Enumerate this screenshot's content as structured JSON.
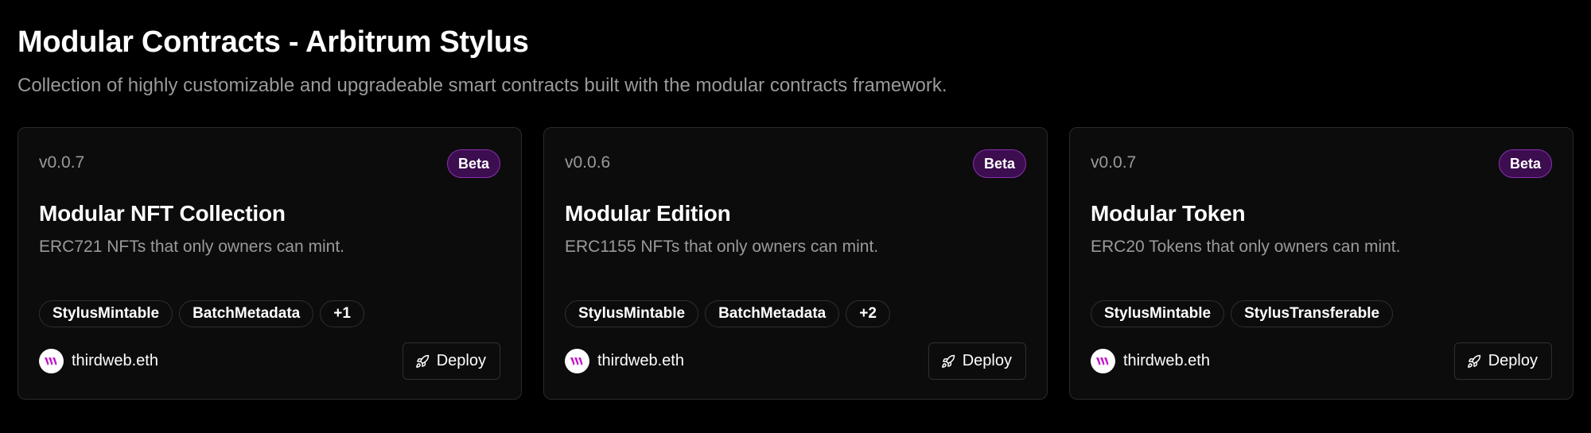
{
  "header": {
    "title": "Modular Contracts - Arbitrum Stylus",
    "subtitle": "Collection of highly customizable and upgradeable smart contracts built with the modular contracts framework."
  },
  "colors": {
    "background": "#000000",
    "card": "#0c0c0d",
    "badge_bg": "#3c0d4f",
    "badge_border": "#8a2fb3",
    "logo": "#c019c9"
  },
  "cards": [
    {
      "version": "v0.0.7",
      "badge": "Beta",
      "title": "Modular NFT Collection",
      "description": "ERC721 NFTs that only owners can mint.",
      "tags": [
        "StylusMintable",
        "BatchMetadata",
        "+1"
      ],
      "author": "thirdweb.eth",
      "author_icon": "thirdweb-logo-icon",
      "deploy_label": "Deploy",
      "deploy_icon": "rocket-icon"
    },
    {
      "version": "v0.0.6",
      "badge": "Beta",
      "title": "Modular Edition",
      "description": "ERC1155 NFTs that only owners can mint.",
      "tags": [
        "StylusMintable",
        "BatchMetadata",
        "+2"
      ],
      "author": "thirdweb.eth",
      "author_icon": "thirdweb-logo-icon",
      "deploy_label": "Deploy",
      "deploy_icon": "rocket-icon"
    },
    {
      "version": "v0.0.7",
      "badge": "Beta",
      "title": "Modular Token",
      "description": "ERC20 Tokens that only owners can mint.",
      "tags": [
        "StylusMintable",
        "StylusTransferable"
      ],
      "author": "thirdweb.eth",
      "author_icon": "thirdweb-logo-icon",
      "deploy_label": "Deploy",
      "deploy_icon": "rocket-icon"
    }
  ]
}
